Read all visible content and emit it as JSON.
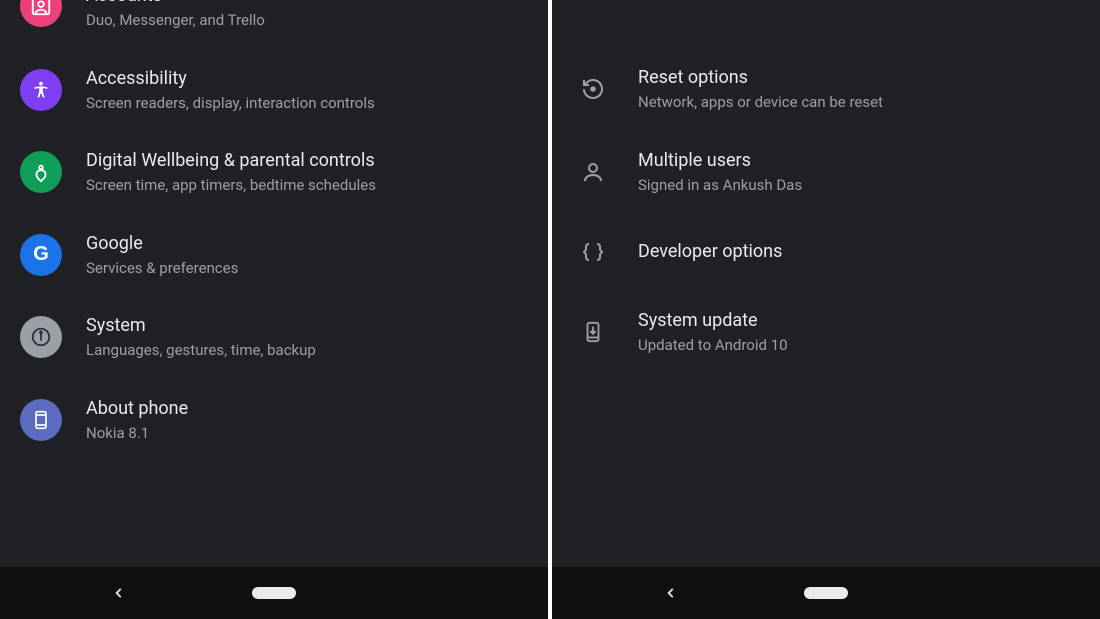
{
  "left": {
    "items": [
      {
        "title": "Accounts",
        "subtitle": "Duo, Messenger, and Trello",
        "color": "#ec407a"
      },
      {
        "title": "Accessibility",
        "subtitle": "Screen readers, display, interaction controls",
        "color": "#7e3ff2"
      },
      {
        "title": "Digital Wellbeing & parental controls",
        "subtitle": "Screen time, app timers, bedtime schedules",
        "color": "#0f9d58"
      },
      {
        "title": "Google",
        "subtitle": "Services & preferences",
        "color": "#1a73e8"
      },
      {
        "title": "System",
        "subtitle": "Languages, gestures, time, backup",
        "color": "#9aa0a6"
      },
      {
        "title": "About phone",
        "subtitle": "Nokia 8.1",
        "color": "#5c6bc0"
      }
    ]
  },
  "right": {
    "items": [
      {
        "title": "Reset options",
        "subtitle": "Network, apps or device can be reset"
      },
      {
        "title": "Multiple users",
        "subtitle": "Signed in as Ankush Das"
      },
      {
        "title": "Developer options",
        "subtitle": ""
      },
      {
        "title": "System update",
        "subtitle": "Updated to Android 10"
      }
    ]
  }
}
